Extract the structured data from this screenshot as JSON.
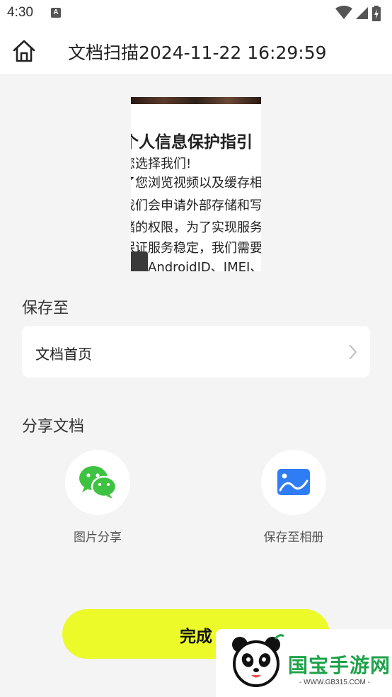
{
  "status_bar": {
    "time": "4:30",
    "notification_icon": "A"
  },
  "header": {
    "title": "文档扫描2024-11-22 16:29:59",
    "home_icon": "home-icon"
  },
  "preview": {
    "heading": "个人信息保护指引",
    "lines": [
      "您选择我们!",
      "了您浏览视频以及缓存相",
      "我们会申请外部存储和写",
      "储的权限，为了实现服务",
      "保证服务稳定，我们需要",
      "息（AndroidID、IMEI、"
    ]
  },
  "save_section": {
    "label": "保存至",
    "destination": "文档首页"
  },
  "share_section": {
    "label": "分享文档",
    "options": [
      {
        "label": "图片分享",
        "icon": "wechat-icon",
        "color": "#3ec241"
      },
      {
        "label": "保存至相册",
        "icon": "gallery-icon",
        "color": "#2f7df5"
      }
    ]
  },
  "done_button": {
    "label": "完成",
    "color": "#ecfa2a"
  },
  "watermark": {
    "text": "国宝手游网",
    "url": "- WWW.GB315.COM -"
  }
}
